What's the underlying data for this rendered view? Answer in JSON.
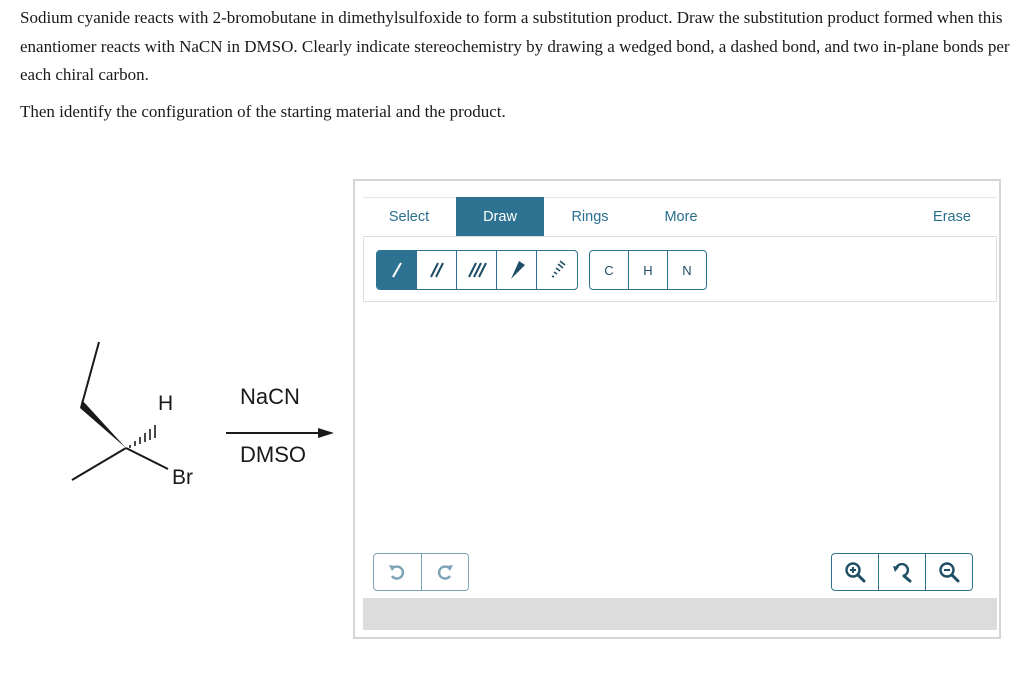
{
  "question": {
    "paragraph1": "Sodium cyanide reacts with 2-bromobutane in dimethylsulfoxide to form a substitution product. Draw the substitution product formed when this enantiomer reacts with NaCN in DMSO. Clearly indicate stereochemistry by drawing a wedged bond, a dashed bond, and two in-plane bonds per each chiral carbon.",
    "paragraph2": "Then identify the configuration of the starting material and the product."
  },
  "reaction": {
    "atom_h": "H",
    "atom_br": "Br",
    "reagent": "NaCN",
    "solvent": "DMSO"
  },
  "editor": {
    "tabs": [
      {
        "label": "Select",
        "active": false
      },
      {
        "label": "Draw",
        "active": true
      },
      {
        "label": "Rings",
        "active": false
      },
      {
        "label": "More",
        "active": false
      },
      {
        "label": "Erase",
        "active": false
      }
    ],
    "bond_tools": [
      {
        "icon": "single-bond-icon",
        "active": true
      },
      {
        "icon": "double-bond-icon",
        "active": false
      },
      {
        "icon": "triple-bond-icon",
        "active": false
      },
      {
        "icon": "wedge-bond-icon",
        "active": false
      },
      {
        "icon": "dash-bond-icon",
        "active": false
      }
    ],
    "atoms": [
      "C",
      "H",
      "N"
    ],
    "history": [
      "undo-icon",
      "redo-icon"
    ],
    "zoom": [
      "zoom-in-icon",
      "zoom-reset-icon",
      "zoom-out-icon"
    ],
    "accent_color": "#2e7291"
  }
}
